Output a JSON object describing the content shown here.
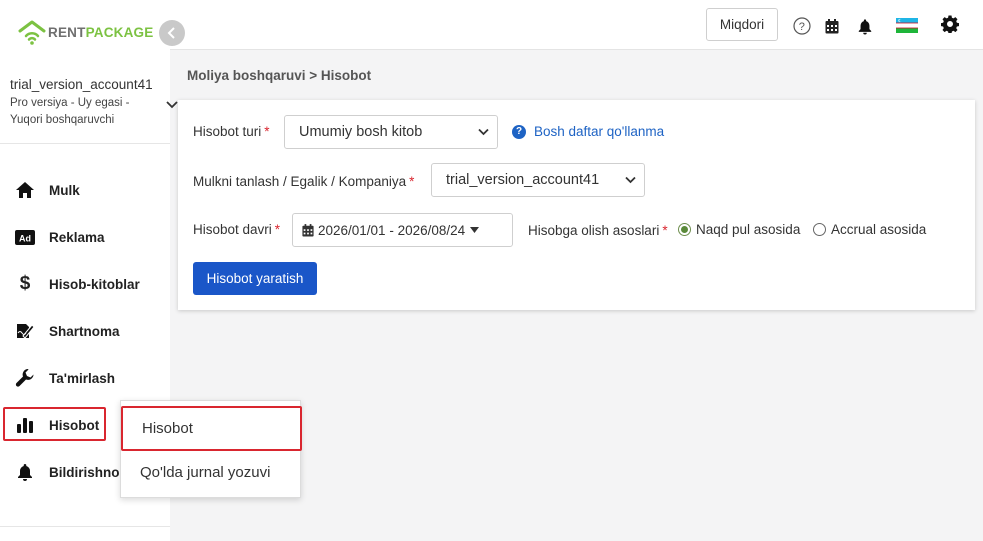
{
  "brand": {
    "name_part1": "RENT",
    "name_part2": "PACKAGE",
    "color_primary": "#7cc242",
    "color_text": "#6f6f6f"
  },
  "account": {
    "name": "trial_version_account41",
    "line2": "Pro versiya - Uy egasi -",
    "line3": "Yuqori boshqaruvchi"
  },
  "sidebar": {
    "items": [
      {
        "label": "Mulk",
        "icon": "home-icon"
      },
      {
        "label": "Reklama",
        "icon": "ad-icon"
      },
      {
        "label": "Hisob-kitoblar",
        "icon": "dollar-icon"
      },
      {
        "label": "Shartnoma",
        "icon": "contract-icon"
      },
      {
        "label": "Ta'mirlash",
        "icon": "wrench-icon"
      },
      {
        "label": "Hisobot",
        "icon": "bar-chart-icon",
        "active": true
      },
      {
        "label": "Bildirishnoma",
        "icon": "bell-icon"
      }
    ]
  },
  "topbar": {
    "quantity_button": "Miqdori",
    "icons": [
      "help-icon",
      "calendar-icon",
      "bell-icon",
      "flag-icon",
      "gear-icon"
    ]
  },
  "breadcrumb": "Moliya boshqaruvi > Hisobot",
  "form": {
    "report_type_label": "Hisobot turi",
    "report_type_value": "Umumiy bosh kitob",
    "help_link": "Bosh daftar qo'llanma",
    "property_label": "Mulkni tanlash / Egalik / Kompaniya",
    "property_value": "trial_version_account41",
    "period_label": "Hisobot davri",
    "period_value": "2026/01/01 - 2026/08/24",
    "basis_label": "Hisobga olish asoslari",
    "basis_options": [
      {
        "label": "Naqd pul asosida",
        "selected": true
      },
      {
        "label": "Accrual asosida",
        "selected": false
      }
    ],
    "submit_label": "Hisobot yaratish",
    "required_mark": "*"
  },
  "popup_menu": {
    "items": [
      {
        "label": "Hisobot"
      },
      {
        "label": "Qo'lda jurnal yozuvi"
      }
    ]
  },
  "colors": {
    "accent": "#1a56c8",
    "highlight_border": "#d9262f",
    "link": "#1e63c4"
  }
}
